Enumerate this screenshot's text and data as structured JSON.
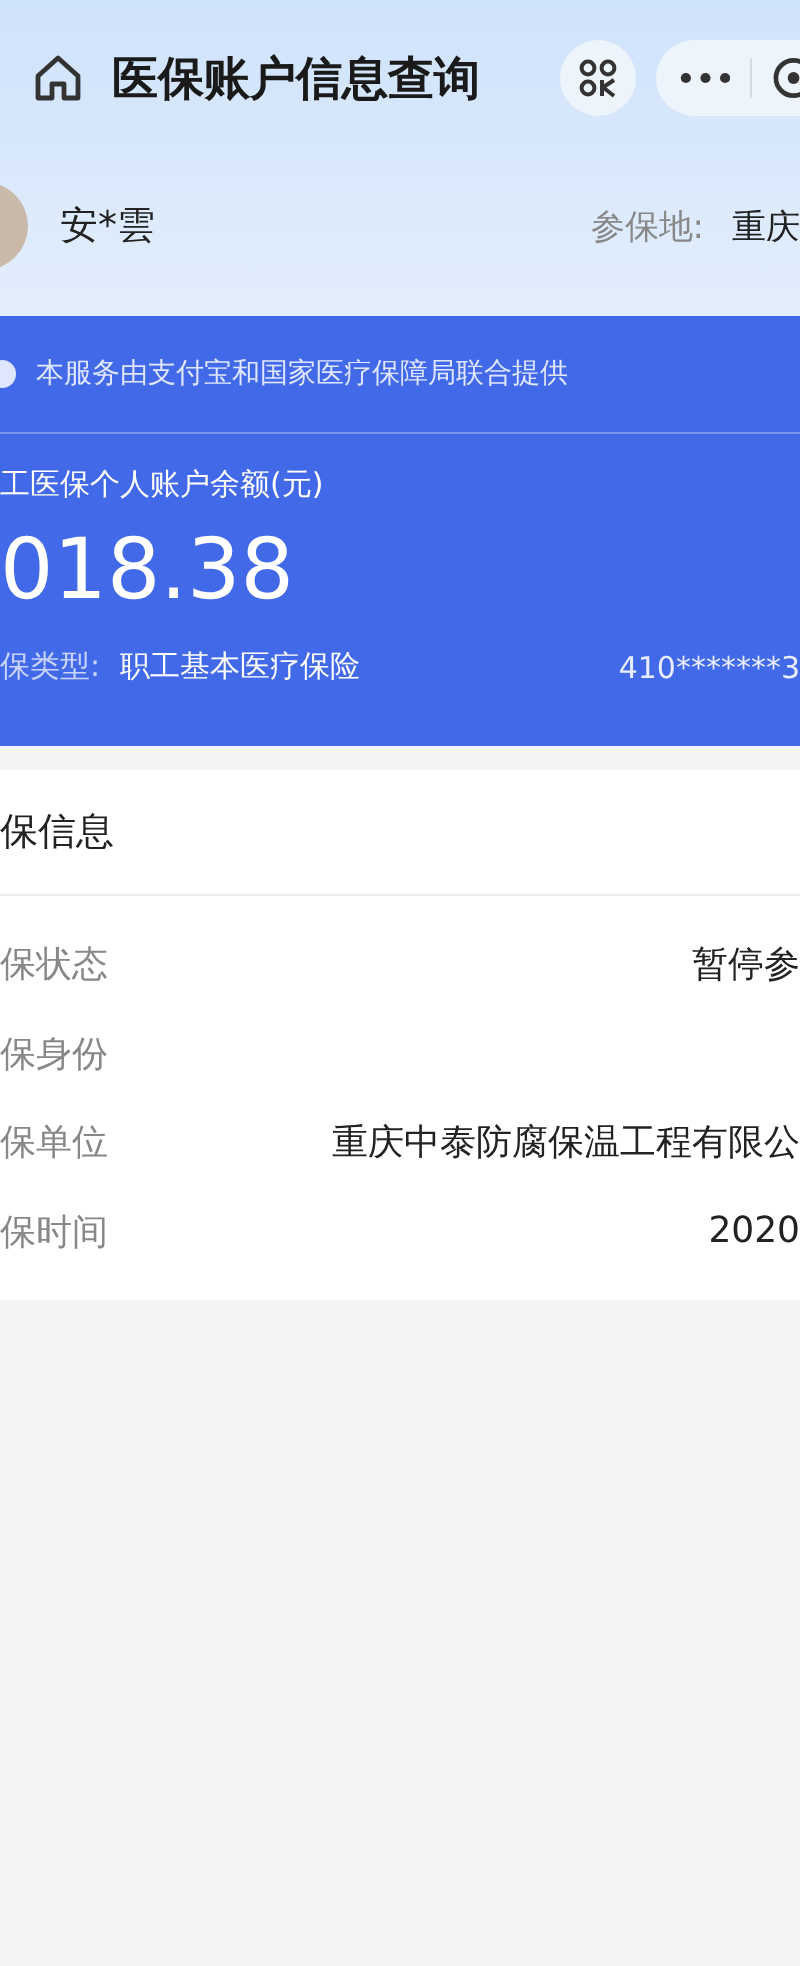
{
  "nav_bar": {
    "title": "医保账户信息查询"
  },
  "user": {
    "name": "安*雲",
    "region_label": "参保地:",
    "region_value": "重庆"
  },
  "account_card": {
    "notice": "本服务由支付宝和国家医疗保障局联合提供",
    "balance_label": "工医保个人账户余额(元)",
    "balance": "018.38",
    "type_label": "保类型:",
    "type_value": "职工基本医疗保险",
    "id_number": "410*******3"
  },
  "info_section": {
    "title": "保信息",
    "rows": [
      {
        "label": "保状态",
        "value": "暂停参"
      },
      {
        "label": "保身份"
      },
      {
        "label": "保单位",
        "value": "重庆中泰防腐保温工程有限公"
      },
      {
        "label": "保时间",
        "value": "2020"
      }
    ]
  }
}
